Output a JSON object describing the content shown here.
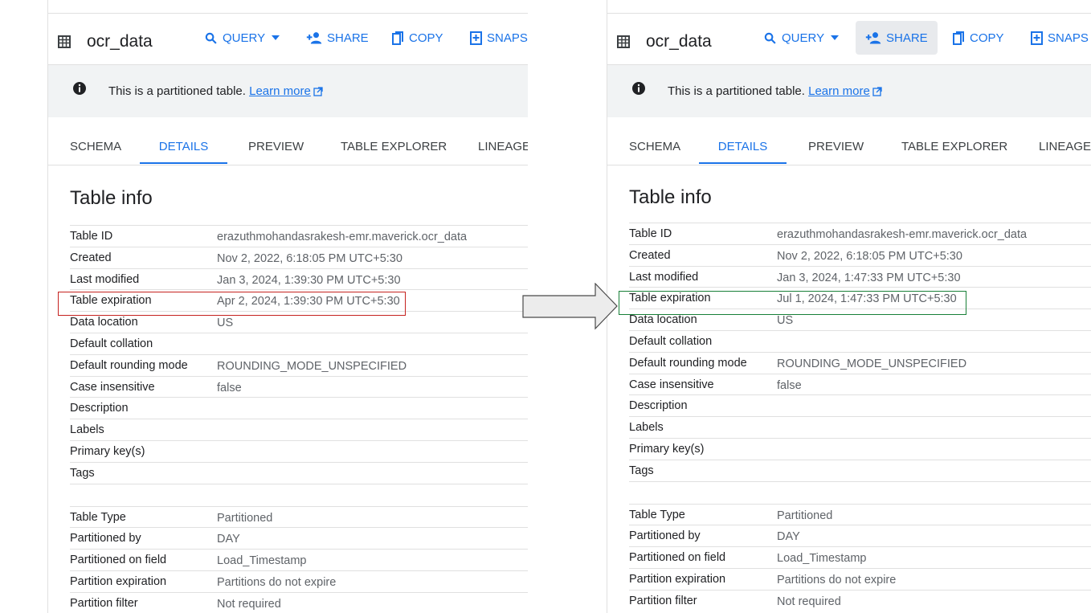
{
  "dataset": {
    "title": "ocr_data",
    "info_text": "This is a partitioned table.",
    "learn_more": "Learn more"
  },
  "toolbar": {
    "query": "QUERY",
    "share": "SHARE",
    "copy": "COPY",
    "snapshot_left": "SNAPSI",
    "snapshot_right": "SNAPS"
  },
  "tabs": {
    "schema": "SCHEMA",
    "details": "DETAILS",
    "preview": "PREVIEW",
    "explorer": "TABLE EXPLORER",
    "lineage": "LINEAGE"
  },
  "section_title": "Table info",
  "labels": {
    "table_id": "Table ID",
    "created": "Created",
    "last_modified": "Last modified",
    "table_expiration": "Table expiration",
    "data_location": "Data location",
    "default_collation": "Default collation",
    "default_rounding": "Default rounding mode",
    "case_insensitive": "Case insensitive",
    "description": "Description",
    "labels": "Labels",
    "primary_keys": "Primary key(s)",
    "tags": "Tags",
    "table_type": "Table Type",
    "partitioned_by": "Partitioned by",
    "partitioned_on_field": "Partitioned on field",
    "partition_expiration": "Partition expiration",
    "partition_filter": "Partition filter"
  },
  "left": {
    "table_id": "erazuthmohandasrakesh-emr.maverick.ocr_data",
    "created": "Nov 2, 2022, 6:18:05 PM UTC+5:30",
    "last_modified": "Jan 3, 2024, 1:39:30 PM UTC+5:30",
    "table_expiration": "Apr 2, 2024, 1:39:30 PM UTC+5:30",
    "data_location": "US",
    "default_collation": "",
    "default_rounding": "ROUNDING_MODE_UNSPECIFIED",
    "case_insensitive": "false",
    "description": "",
    "labels": "",
    "primary_keys": "",
    "tags": "",
    "table_type": "Partitioned",
    "partitioned_by": "DAY",
    "partitioned_on_field": "Load_Timestamp",
    "partition_expiration": "Partitions do not expire",
    "partition_filter": "Not required"
  },
  "right": {
    "table_id": "erazuthmohandasrakesh-emr.maverick.ocr_data",
    "created": "Nov 2, 2022, 6:18:05 PM UTC+5:30",
    "last_modified": "Jan 3, 2024, 1:47:33 PM UTC+5:30",
    "table_expiration": "Jul 1, 2024, 1:47:33 PM UTC+5:30",
    "data_location": "US",
    "default_collation": "",
    "default_rounding": "ROUNDING_MODE_UNSPECIFIED",
    "case_insensitive": "false",
    "description": "",
    "labels": "",
    "primary_keys": "",
    "tags": "",
    "table_type": "Partitioned",
    "partitioned_by": "DAY",
    "partitioned_on_field": "Load_Timestamp",
    "partition_expiration": "Partitions do not expire",
    "partition_filter": "Not required"
  },
  "colors": {
    "accent": "#1a73e8",
    "before_highlight": "#c5221f",
    "after_highlight": "#188038"
  }
}
